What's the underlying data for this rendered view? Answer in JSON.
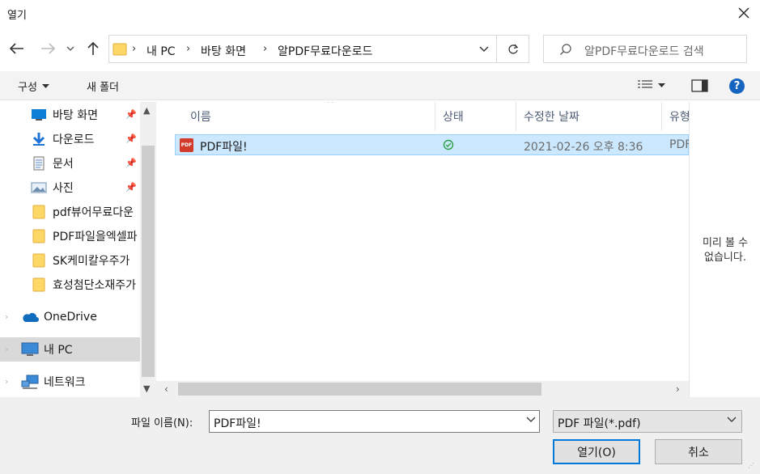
{
  "window": {
    "title": "열기"
  },
  "address": {
    "crumbs": [
      "내 PC",
      "바탕 화면",
      "알PDF무료다운로드"
    ]
  },
  "search": {
    "placeholder": "알PDF무료다운로드 검색"
  },
  "toolbar": {
    "organize_label": "구성",
    "new_folder_label": "새 폴더"
  },
  "nav": {
    "items": [
      {
        "label": "바탕 화면",
        "icon": "desktop-icon",
        "pinned": true
      },
      {
        "label": "다운로드",
        "icon": "download-icon",
        "pinned": true
      },
      {
        "label": "문서",
        "icon": "document-icon",
        "pinned": true
      },
      {
        "label": "사진",
        "icon": "picture-icon",
        "pinned": true
      },
      {
        "label": "pdf뷰어무료다운",
        "icon": "folder-icon",
        "pinned": false
      },
      {
        "label": "PDF파일을엑셀파",
        "icon": "folder-icon",
        "pinned": false
      },
      {
        "label": "SK케미칼우주가",
        "icon": "folder-icon",
        "pinned": false
      },
      {
        "label": "효성첨단소재주가",
        "icon": "folder-icon",
        "pinned": false
      },
      {
        "label": "OneDrive",
        "icon": "onedrive-icon",
        "pinned": false
      },
      {
        "label": "내 PC",
        "icon": "pc-icon",
        "pinned": false
      },
      {
        "label": "네트워크",
        "icon": "network-icon",
        "pinned": false
      }
    ]
  },
  "columns": {
    "name": "이름",
    "status": "상태",
    "modified": "수정한 날짜",
    "type": "유형"
  },
  "files": [
    {
      "name": "PDF파일!",
      "modified": "2021-02-26 오후 8:36",
      "type": "PDF",
      "icon_text": "PDF",
      "status_color": "#2e9e44"
    }
  ],
  "preview": {
    "line1": "미리 볼 수",
    "line2": "없습니다."
  },
  "bottom": {
    "filename_label": "파일 이름(N):",
    "filename_value": "PDF파일!",
    "filetype_value": "PDF 파일(*.pdf)",
    "open_label": "열기(O)",
    "cancel_label": "취소"
  },
  "colors": {
    "accent": "#0078d7",
    "selection": "#cce8ff",
    "folder": "#ffd766"
  }
}
